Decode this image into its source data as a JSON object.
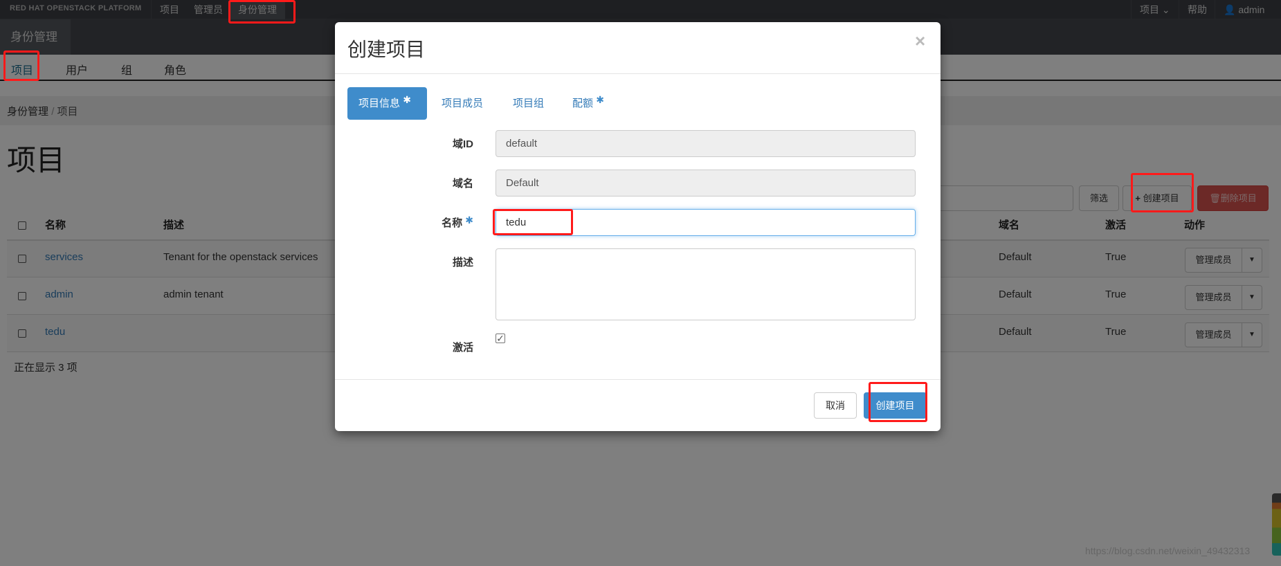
{
  "topbar": {
    "brand": "RED HAT OPENSTACK PLATFORM",
    "nav": [
      "项目",
      "管理员",
      "身份管理"
    ],
    "project_menu": "项目",
    "help": "帮助",
    "user": "admin"
  },
  "section_tab": "身份管理",
  "subnav": [
    "项目",
    "用户",
    "组",
    "角色"
  ],
  "breadcrumb": {
    "parent": "身份管理",
    "sep": "/",
    "current": "项目"
  },
  "page_title": "项目",
  "toolbar": {
    "filter": "筛选",
    "create": "创建项目",
    "delete": "删除项目"
  },
  "table": {
    "headers": [
      "名称",
      "描述",
      "域名",
      "激活",
      "动作"
    ],
    "rows": [
      {
        "name": "services",
        "description": "Tenant for the openstack services",
        "domain": "Default",
        "enabled": "True",
        "action": "管理成员"
      },
      {
        "name": "admin",
        "description": "admin tenant",
        "domain": "Default",
        "enabled": "True",
        "action": "管理成员"
      },
      {
        "name": "tedu",
        "description": "",
        "domain": "Default",
        "enabled": "True",
        "action": "管理成员"
      }
    ],
    "footer": "正在显示 3 项"
  },
  "modal": {
    "title": "创建项目",
    "close": "×",
    "tabs": [
      {
        "label": "项目信息",
        "required": "✱"
      },
      {
        "label": "项目成员"
      },
      {
        "label": "项目组"
      },
      {
        "label": "配额",
        "required": "✱"
      }
    ],
    "fields": {
      "domain_id_label": "域ID",
      "domain_id": "default",
      "domain_name_label": "域名",
      "domain_name": "Default",
      "name_label": "名称",
      "name_required": "✱",
      "name": "tedu",
      "desc_label": "描述",
      "desc": "",
      "enabled_label": "激活",
      "enabled": true
    },
    "cancel": "取消",
    "submit": "创建项目"
  },
  "watermark": "https://blog.csdn.net/weixin_49432313",
  "colors": {
    "primary": "#3f8ccb",
    "danger": "#d9534f",
    "annotation": "#ff1a1a"
  }
}
